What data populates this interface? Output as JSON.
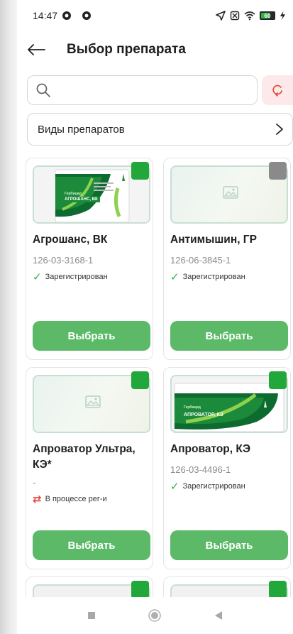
{
  "status_bar": {
    "time": "14:47",
    "battery": "60"
  },
  "header": {
    "title": "Выбор препарата"
  },
  "search": {
    "placeholder": "",
    "value": ""
  },
  "category": {
    "label": "Виды препаратов"
  },
  "cards": [
    {
      "name": "Агрошанс, ВК",
      "code": "126-03-3168-1",
      "status": "Зарегистрирован",
      "status_type": "registered",
      "checked": true,
      "image": "product-photo",
      "pack_label": "АГРОШАНС, ВК",
      "pack_caption": "Гербицид",
      "button": "Выбрать"
    },
    {
      "name": "Антимышин, ГР",
      "code": "126-06-3845-1",
      "status": "Зарегистрирован",
      "status_type": "registered",
      "checked": false,
      "image": "placeholder",
      "button": "Выбрать"
    },
    {
      "name": "Апроватор Ультра, КЭ*",
      "code": "-",
      "status": "В процессе рег-и",
      "status_type": "in-progress",
      "checked": true,
      "image": "placeholder",
      "button": "Выбрать"
    },
    {
      "name": "Апроватор, КЭ",
      "code": "126-03-4496-1",
      "status": "Зарегистрирован",
      "status_type": "registered",
      "checked": true,
      "image": "product-photo",
      "pack_label": "АПРОВАТОР, КЭ",
      "pack_caption": "Гербицид",
      "button": "Выбрать"
    }
  ],
  "colors": {
    "accent_green": "#5cb968",
    "checkbox_green": "#22a83a",
    "checkbox_grey": "#8a8a8a",
    "status_green": "#2db24a",
    "status_red": "#e0463a",
    "reset_bg": "#fde9e9"
  },
  "icons": {
    "back": "arrow-left-icon",
    "search": "search-icon",
    "reset": "refresh-icon",
    "chevron": "chevron-right-icon",
    "registered": "checkmark-icon",
    "in_progress": "sync-icon"
  }
}
